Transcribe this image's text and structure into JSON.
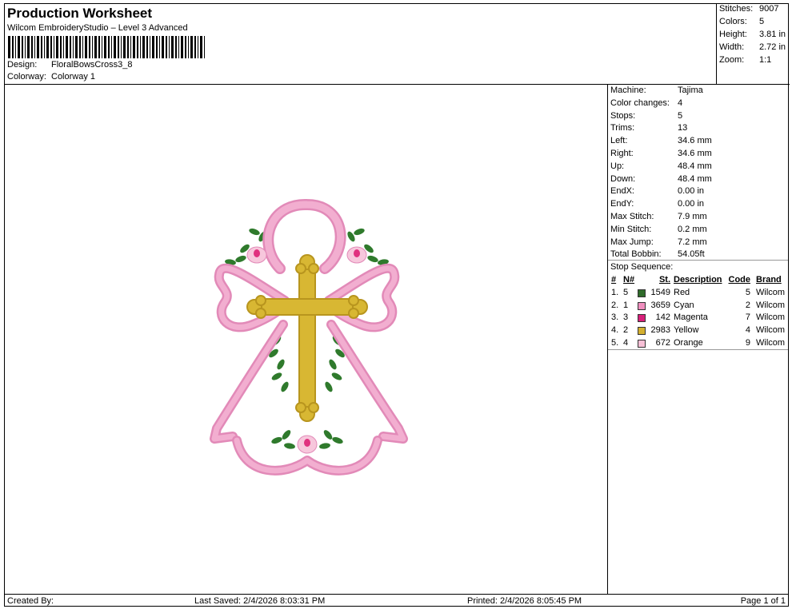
{
  "header": {
    "title": "Production Worksheet",
    "subtitle": "Wilcom EmbroideryStudio – Level 3 Advanced",
    "design_label": "Design:",
    "design_value": "FloralBowsCross3_8",
    "colorway_label": "Colorway:",
    "colorway_value": "Colorway 1"
  },
  "summary": {
    "stitches_label": "Stitches:",
    "stitches_value": "9007",
    "colors_label": "Colors:",
    "colors_value": "5",
    "height_label": "Height:",
    "height_value": "3.81 in",
    "width_label": "Width:",
    "width_value": "2.72 in",
    "zoom_label": "Zoom:",
    "zoom_value": "1:1"
  },
  "machine_info": [
    {
      "label": "Machine:",
      "value": "Tajima"
    },
    {
      "label": "Color changes:",
      "value": "4"
    },
    {
      "label": "Stops:",
      "value": "5"
    },
    {
      "label": "Trims:",
      "value": "13"
    },
    {
      "label": "Left:",
      "value": "34.6 mm"
    },
    {
      "label": "Right:",
      "value": "34.6 mm"
    },
    {
      "label": "Up:",
      "value": "48.4 mm"
    },
    {
      "label": "Down:",
      "value": "48.4 mm"
    },
    {
      "label": "EndX:",
      "value": "0.00 in"
    },
    {
      "label": "EndY:",
      "value": "0.00 in"
    },
    {
      "label": "Max Stitch:",
      "value": "7.9 mm"
    },
    {
      "label": "Min Stitch:",
      "value": "0.2 mm"
    },
    {
      "label": "Max Jump:",
      "value": "7.2 mm"
    },
    {
      "label": "Total Bobbin:",
      "value": "54.05ft"
    }
  ],
  "stops": {
    "title": "Stop Sequence:",
    "headers": {
      "idx": "#",
      "n": "N#",
      "st": "St.",
      "desc": "Description",
      "code": "Code",
      "brand": "Brand"
    },
    "rows": [
      {
        "idx": "1.",
        "n": "5",
        "color": "#2f6b2a",
        "st": "1549",
        "desc": "Red",
        "code": "5",
        "brand": "Wilcom"
      },
      {
        "idx": "2.",
        "n": "1",
        "color": "#f08fbf",
        "st": "3659",
        "desc": "Cyan",
        "code": "2",
        "brand": "Wilcom"
      },
      {
        "idx": "3.",
        "n": "3",
        "color": "#d8207a",
        "st": "142",
        "desc": "Magenta",
        "code": "7",
        "brand": "Wilcom"
      },
      {
        "idx": "4.",
        "n": "2",
        "color": "#d4b030",
        "st": "2983",
        "desc": "Yellow",
        "code": "4",
        "brand": "Wilcom"
      },
      {
        "idx": "5.",
        "n": "4",
        "color": "#f7c0d6",
        "st": "672",
        "desc": "Orange",
        "code": "9",
        "brand": "Wilcom"
      }
    ]
  },
  "footer": {
    "created_by": "Created By:",
    "last_saved": "Last Saved: 2/4/2026 8:03:31 PM",
    "printed": "Printed: 2/4/2026 8:05:45 PM",
    "page": "Page 1 of 1"
  },
  "design_colors": {
    "ribbon": "#f2aed0",
    "ribbon_dark": "#e28ab8",
    "cross": "#d8b733",
    "cross_dark": "#b8951e",
    "leaf": "#2f7a2c",
    "rose": "#f7c7dc",
    "rose_center": "#e0317f"
  }
}
